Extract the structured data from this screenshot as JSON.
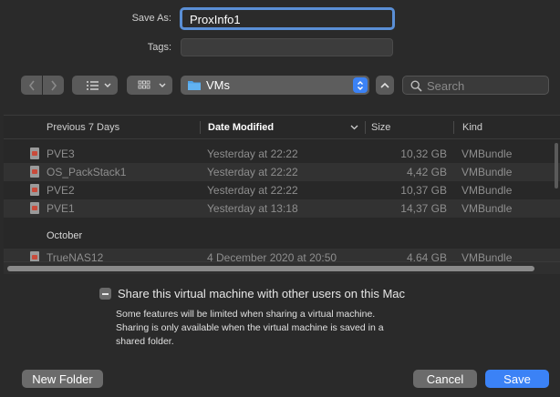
{
  "form": {
    "save_as_label": "Save As:",
    "save_as_value": "ProxInfo1",
    "tags_label": "Tags:",
    "tags_value": ""
  },
  "toolbar": {
    "location": "VMs",
    "search_placeholder": "Search",
    "icons": [
      "chevron-left-icon",
      "chevron-right-icon",
      "list-view-icon",
      "grid-view-icon",
      "folder-icon",
      "chevron-up-icon",
      "search-icon"
    ]
  },
  "table": {
    "headers": {
      "name": "Previous 7 Days",
      "date": "Date Modified",
      "size": "Size",
      "kind": "Kind"
    },
    "rows": [
      {
        "name": "PVE3",
        "date": "Yesterday at 22:22",
        "size": "10,32 GB",
        "kind": "VMBundle"
      },
      {
        "name": "OS_PackStack1",
        "date": "Yesterday at 22:22",
        "size": "4,42 GB",
        "kind": "VMBundle"
      },
      {
        "name": "PVE2",
        "date": "Yesterday at 22:22",
        "size": "10,37 GB",
        "kind": "VMBundle"
      },
      {
        "name": "PVE1",
        "date": "Yesterday at 13:18",
        "size": "14,37 GB",
        "kind": "VMBundle"
      }
    ],
    "section_october": "October",
    "october_rows": [
      {
        "name": "TrueNAS12",
        "date": "4 December 2020 at 20:50",
        "size": "4,64 GB",
        "kind": "VMBundle"
      }
    ]
  },
  "sharing": {
    "checkbox_label": "Share this virtual machine with other users on this Mac",
    "note_line1": "Some features will be limited when sharing a virtual machine.",
    "note_line2": "Sharing is only available when the virtual machine is saved in a",
    "note_line3": "shared folder."
  },
  "buttons": {
    "new_folder": "New Folder",
    "cancel": "Cancel",
    "save": "Save"
  },
  "colors": {
    "accent": "#3b82f6",
    "background": "#2a2a2a",
    "focus_ring": "#5a8fd6"
  }
}
